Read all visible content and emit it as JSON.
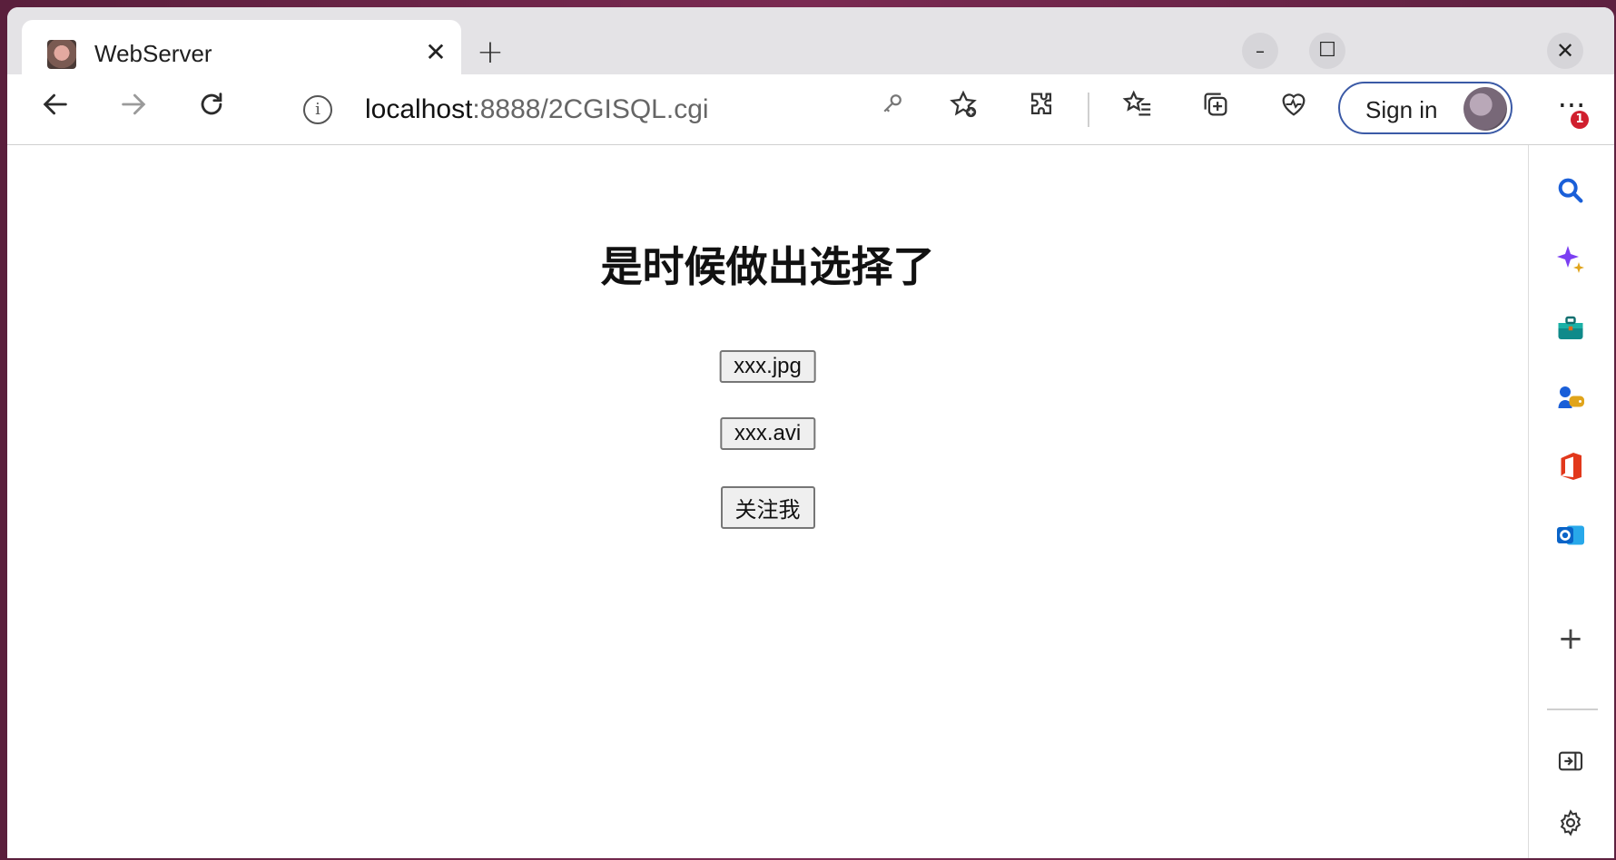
{
  "browser": {
    "tab": {
      "title": "WebServer"
    },
    "address": {
      "host": "localhost",
      "path": ":8888/2CGISQL.cgi"
    },
    "signin_label": "Sign in",
    "notification_count": "1"
  },
  "page": {
    "heading": "是时候做出选择了",
    "buttons": [
      "xxx.jpg",
      "xxx.avi",
      "关注我"
    ]
  },
  "colors": {
    "tabstrip_bg": "#e4e3e6",
    "signin_border": "#3b5aa6",
    "badge": "#d01f2e"
  },
  "icons": {
    "back": "arrow-left-icon",
    "forward": "arrow-right-icon",
    "refresh": "refresh-icon",
    "info": "info-icon",
    "password": "key-icon",
    "favorite_add": "star-add-icon",
    "extensions": "puzzle-icon",
    "favorites": "favorites-icon",
    "collections": "collections-icon",
    "performance": "heart-pulse-icon",
    "sidebar": [
      "search-icon",
      "copilot-icon",
      "briefcase-icon",
      "games-icon",
      "office-icon",
      "outlook-icon",
      "plus-icon",
      "sidebar-collapse-icon",
      "gear-icon"
    ]
  }
}
